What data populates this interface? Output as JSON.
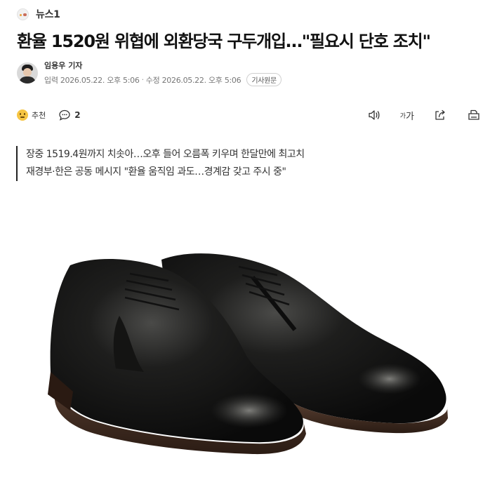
{
  "source": {
    "name": "뉴스1",
    "logo_icon": "news1-logo"
  },
  "article": {
    "title": "환율 1520원 위협에 외환당국 구두개입…\"필요시 단호 조치\"",
    "reporter": "임용우 기자",
    "published": "입력 2026.05.22. 오후 5:06",
    "modified": "수정 2026.05.22. 오후 5:06",
    "date_separator": "·",
    "original_link_label": "기사원문",
    "subheadings": [
      "장중 1519.4원까지 치솟아…오후 들어 오름폭 키우며 한달만에 최고치",
      "재경부·한은 공동 메시지 \"환율 움직임 과도…경계감 갖고 주시 중\""
    ]
  },
  "actions": {
    "recommend_label": "추천",
    "comment_count": "2",
    "font_size_label": "가"
  },
  "photo": {
    "subject": "black leather derby shoes",
    "alt": ""
  }
}
